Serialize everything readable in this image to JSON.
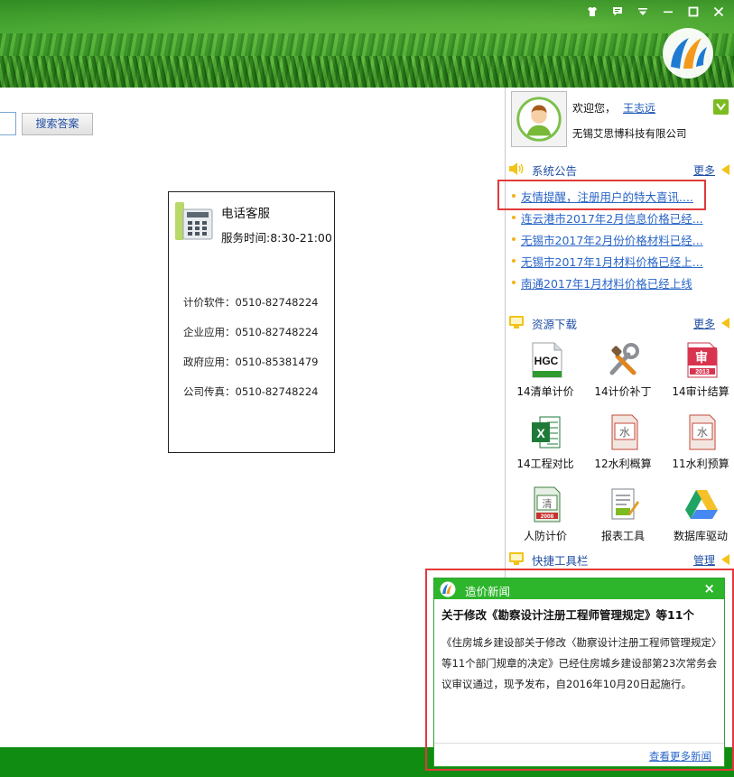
{
  "window": {
    "controls": [
      "skin-icon",
      "message-icon",
      "menu-icon",
      "minimize-icon",
      "maximize-icon",
      "close-icon"
    ]
  },
  "search": {
    "button_label": "搜索答案"
  },
  "service": {
    "title": "电话客服",
    "hours": "服务时间:8:30-21:00",
    "contacts": [
      "计价软件：0510-82748224",
      "企业应用：0510-82748224",
      "政府应用：0510-85381479",
      "公司传真：0510-82748224"
    ]
  },
  "user": {
    "welcome": "欢迎您，",
    "name": "王志远",
    "company": "无锡艾思博科技有限公司"
  },
  "notice": {
    "title": "系统公告",
    "more": "更多",
    "items": [
      "友情提醒，注册用户的特大喜讯....",
      "连云港市2017年2月信息价格已经...",
      "无锡市2017年2月份价格材料已经...",
      "无锡市2017年1月材料价格已经上...",
      "南通2017年1月材料价格已经上线"
    ]
  },
  "resources": {
    "title": "资源下载",
    "more": "更多",
    "items": [
      {
        "label": "14清单计价",
        "icon": "hgc-icon",
        "text": "HGC"
      },
      {
        "label": "14计价补丁",
        "icon": "tools-icon"
      },
      {
        "label": "14审计结算",
        "icon": "audit-icon",
        "text": "审",
        "sub": "2013"
      },
      {
        "label": "14工程对比",
        "icon": "excel-icon",
        "text": "X"
      },
      {
        "label": "12水利概算",
        "icon": "water-icon",
        "text": "水"
      },
      {
        "label": "11水利预算",
        "icon": "water-icon",
        "text": "水"
      },
      {
        "label": "人防计价",
        "icon": "civil-defense-icon",
        "text": "清",
        "sub": "2008"
      },
      {
        "label": "报表工具",
        "icon": "report-icon"
      },
      {
        "label": "数据库驱动",
        "icon": "drive-icon"
      }
    ]
  },
  "toolbar": {
    "title": "快捷工具栏",
    "manage": "管理"
  },
  "popup": {
    "title": "造价新闻",
    "close": "×",
    "headline": "关于修改《勘察设计注册工程师管理规定》等11个",
    "body": "《住房城乡建设部关于修改〈勘察设计注册工程师管理规定〉等11个部门规章的决定》已经住房城乡建设部第23次常务会议审议通过，现予发布，自2016年10月20日起施行。",
    "more": "查看更多新闻"
  },
  "colors": {
    "accent_green": "#2db52c",
    "link_blue": "#1f4ea3",
    "highlight_red": "#e23a3a",
    "bottom_bar": "#118c13"
  }
}
